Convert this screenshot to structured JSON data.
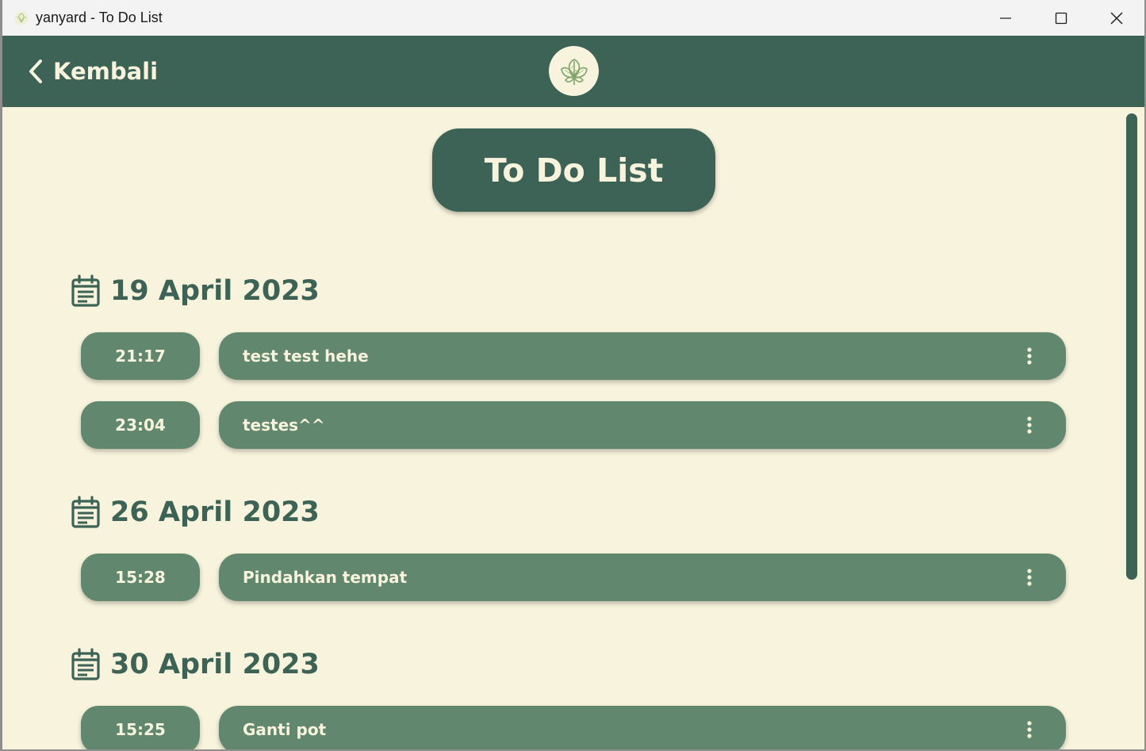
{
  "window": {
    "title": "yanyard - To Do List",
    "controls": [
      "minimize-icon",
      "maximize-icon",
      "close-icon"
    ]
  },
  "header": {
    "back_label": "Kembali",
    "back_icon": "chevron-left-icon",
    "logo_icon": "leaf-logo-icon"
  },
  "page": {
    "title": "To Do List"
  },
  "groups": [
    {
      "date": "19 April 2023",
      "tasks": [
        {
          "time": "21:17",
          "text": "test test hehe"
        },
        {
          "time": "23:04",
          "text": "testes^^"
        }
      ]
    },
    {
      "date": "26 April 2023",
      "tasks": [
        {
          "time": "15:28",
          "text": "Pindahkan tempat"
        }
      ]
    },
    {
      "date": "30 April 2023",
      "tasks": [
        {
          "time": "15:25",
          "text": "Ganti pot"
        }
      ]
    }
  ],
  "colors": {
    "primary": "#3d6356",
    "task_bg": "#62876f",
    "background": "#f7f3dc",
    "text_light": "#f7f3dc"
  }
}
